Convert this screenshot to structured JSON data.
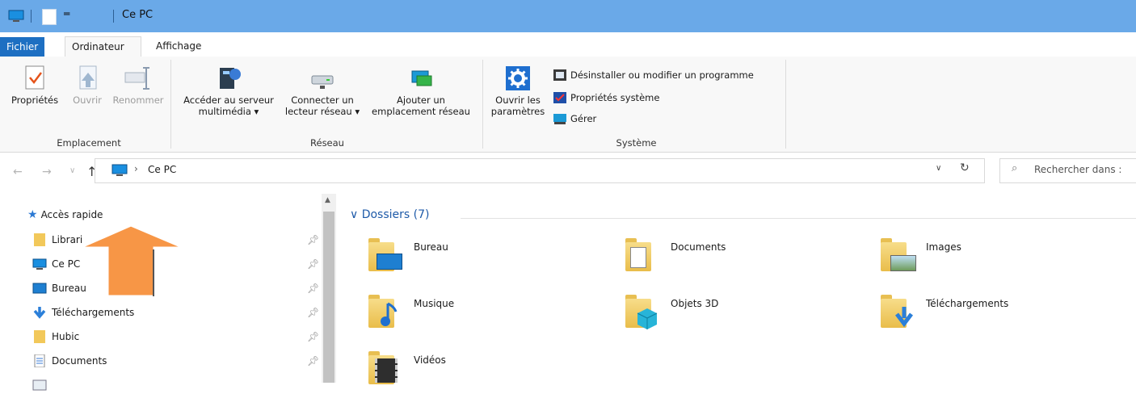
{
  "window": {
    "title": "Ce PC"
  },
  "ribbon_tabs": [
    "Fichier",
    "Ordinateur",
    "Affichage"
  ],
  "ribbon": {
    "emplacement": {
      "label": "Emplacement",
      "proprietes": "Propriétés",
      "ouvrir": "Ouvrir",
      "renommer": "Renommer"
    },
    "reseau": {
      "label": "Réseau",
      "acceder_line1": "Accéder au serveur",
      "acceder_line2": "multimédia ▾",
      "connecter_line1": "Connecter un",
      "connecter_line2": "lecteur réseau ▾",
      "ajouter_line1": "Ajouter un",
      "ajouter_line2": "emplacement réseau"
    },
    "systeme": {
      "label": "Système",
      "ouvrir_line1": "Ouvrir les",
      "ouvrir_line2": "paramètres",
      "desinstaller": "Désinstaller ou modifier un programme",
      "proprietes_systeme": "Propriétés système",
      "gerer": "Gérer"
    }
  },
  "address": {
    "path": "Ce PC",
    "separator": "›",
    "search_placeholder": "Rechercher dans :"
  },
  "nav_pane": {
    "items": [
      {
        "label": "Accès rapide",
        "icon": "star-icon"
      },
      {
        "label": "Librari",
        "icon": "folder-icon"
      },
      {
        "label": "Ce PC",
        "icon": "computer-icon"
      },
      {
        "label": "Bureau",
        "icon": "desktop-icon"
      },
      {
        "label": "Téléchargements",
        "icon": "download-icon"
      },
      {
        "label": "Hubic",
        "icon": "folder-icon"
      },
      {
        "label": "Documents",
        "icon": "document-icon"
      }
    ]
  },
  "content": {
    "section_title": "Dossiers (7)",
    "folders": [
      {
        "name": "Bureau",
        "icon": "desktop-folder-icon"
      },
      {
        "name": "Documents",
        "icon": "documents-folder-icon"
      },
      {
        "name": "Images",
        "icon": "images-folder-icon"
      },
      {
        "name": "Musique",
        "icon": "music-folder-icon"
      },
      {
        "name": "Objets 3D",
        "icon": "3d-objects-folder-icon"
      },
      {
        "name": "Téléchargements",
        "icon": "downloads-folder-icon"
      },
      {
        "name": "Vidéos",
        "icon": "videos-folder-icon"
      }
    ]
  },
  "colors": {
    "titlebar": "#6aa9e8",
    "file_tab": "#1d6fc2",
    "accent_text": "#1e5aa8",
    "annotation_arrow": "#f79646"
  }
}
